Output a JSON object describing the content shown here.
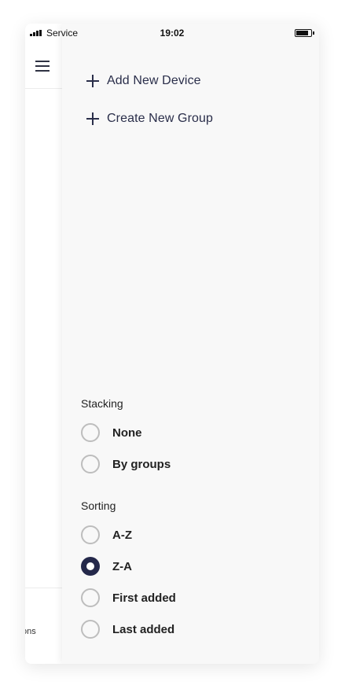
{
  "status_bar": {
    "carrier": "Service",
    "time": "19:02"
  },
  "background_page": {
    "menu_icon": "hamburger-menu-icon",
    "truncated_label": "ons"
  },
  "drawer": {
    "actions": [
      {
        "icon": "plus-icon",
        "label": "Add New Device"
      },
      {
        "icon": "plus-icon",
        "label": "Create New Group"
      }
    ],
    "stacking": {
      "title": "Stacking",
      "selected": null,
      "options": [
        "None",
        "By groups"
      ]
    },
    "sorting": {
      "title": "Sorting",
      "selected": "Z-A",
      "options": [
        "A-Z",
        "Z-A",
        "First added",
        "Last added"
      ]
    }
  },
  "colors": {
    "accent": "#24284a",
    "drawer_background": "#f8f8f8",
    "radio_border": "#bdbdbd"
  }
}
